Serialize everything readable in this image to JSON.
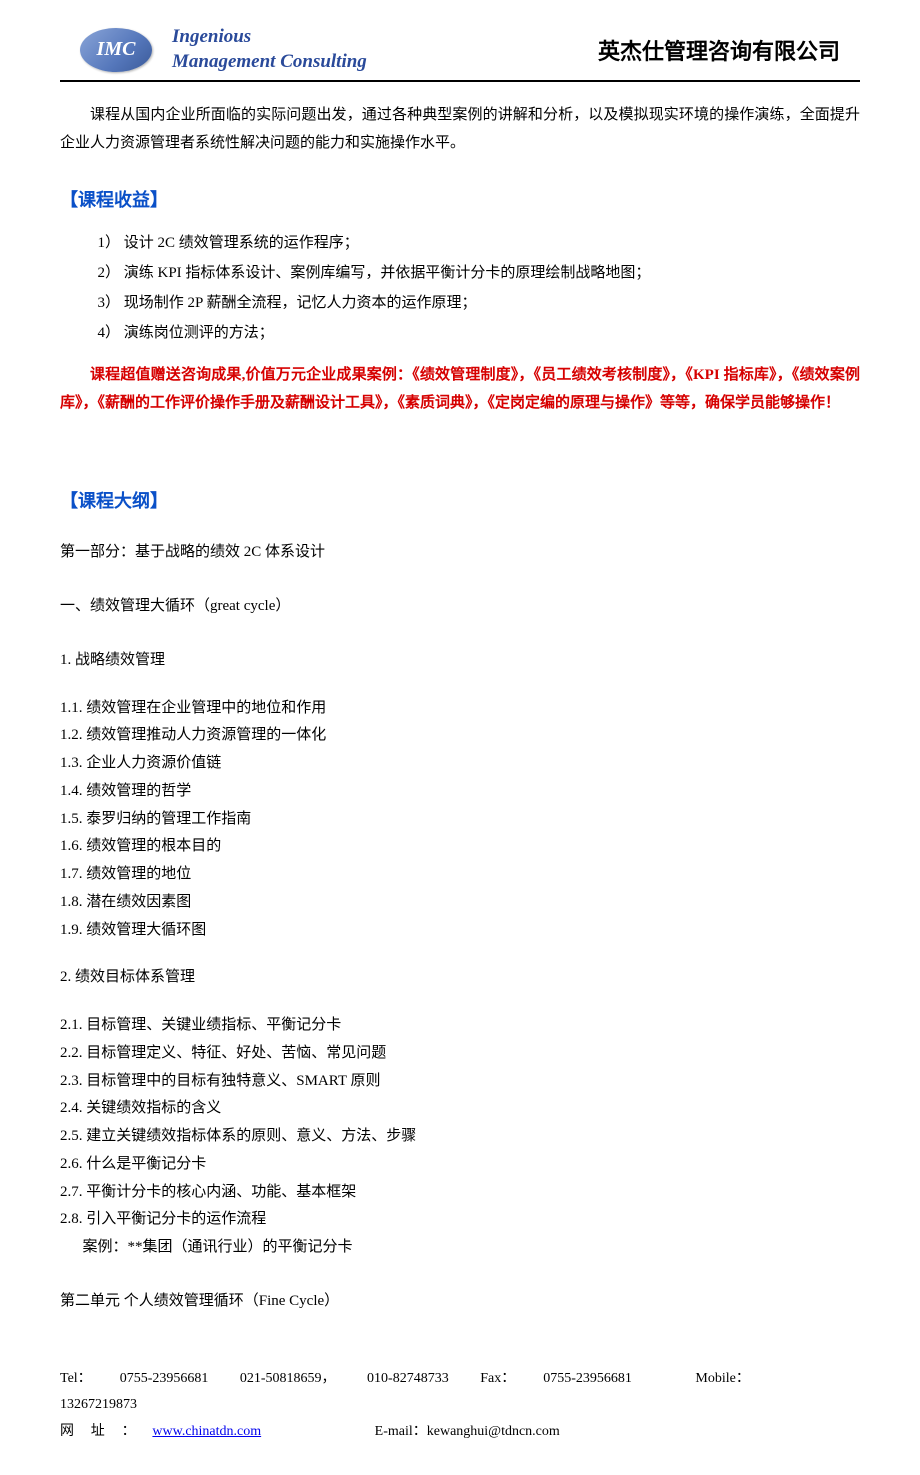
{
  "header": {
    "logo_text": "IMC",
    "en_line1": "Ingenious",
    "en_line2": "Management Consulting",
    "cn_name": "英杰仕管理咨询有限公司"
  },
  "intro": "课程从国内企业所面临的实际问题出发，通过各种典型案例的讲解和分析，以及模拟现实环境的操作演练，全面提升企业人力资源管理者系统性解决问题的能力和实施操作水平。",
  "benefits_title": "【课程收益】",
  "benefits": [
    "1） 设计 2C 绩效管理系统的运作程序；",
    "2） 演练 KPI 指标体系设计、案例库编写，并依据平衡计分卡的原理绘制战略地图；",
    "3） 现场制作 2P 薪酬全流程，记忆人力资本的运作原理；",
    "4） 演练岗位测评的方法；"
  ],
  "red_note": "课程超值赠送咨询成果,价值万元企业成果案例：《绩效管理制度》，《员工绩效考核制度》，《KPI 指标库》，《绩效案例库》，《薪酬的工作评价操作手册及薪酬设计工具》，《素质词典》，《定岗定编的原理与操作》等等，确保学员能够操作！",
  "outline_title": "【课程大纲】",
  "outline": {
    "part1": "第一部分：基于战略的绩效 2C 体系设计",
    "s1": "一、绩效管理大循环（great cycle）",
    "s1_1": "1.  战略绩效管理",
    "s1_items": [
      "1.1. 绩效管理在企业管理中的地位和作用",
      "1.2. 绩效管理推动人力资源管理的一体化",
      "1.3. 企业人力资源价值链",
      "1.4. 绩效管理的哲学",
      "1.5. 泰罗归纳的管理工作指南",
      "1.6. 绩效管理的根本目的",
      "1.7. 绩效管理的地位",
      "1.8. 潜在绩效因素图",
      "1.9. 绩效管理大循环图"
    ],
    "s1_2": "2.  绩效目标体系管理",
    "s2_items": [
      "2.1. 目标管理、关键业绩指标、平衡记分卡",
      "2.2. 目标管理定义、特征、好处、苦恼、常见问题",
      "2.3. 目标管理中的目标有独特意义、SMART 原则",
      "2.4. 关键绩效指标的含义",
      "2.5. 建立关键绩效指标体系的原则、意义、方法、步骤",
      "2.6. 什么是平衡记分卡",
      "2.7. 平衡计分卡的核心内涵、功能、基本框架",
      "2.8. 引入平衡记分卡的运作流程"
    ],
    "s2_case": "      案例：**集团（通讯行业）的平衡记分卡",
    "unit2": "第二单元 个人绩效管理循环（Fine Cycle）"
  },
  "footer": {
    "tel_label": "Tel：",
    "tel1": "0755-23956681",
    "tel2": "021-50818659，",
    "tel3": "010-82748733",
    "fax_label": "Fax：",
    "fax": "0755-23956681",
    "mobile_label": "Mobile：",
    "mobile": "13267219873",
    "web_label": "网址：",
    "web": "www.chinatdn.com",
    "email_label": "E-mail：",
    "email": "kewanghui@tdncn.com"
  }
}
